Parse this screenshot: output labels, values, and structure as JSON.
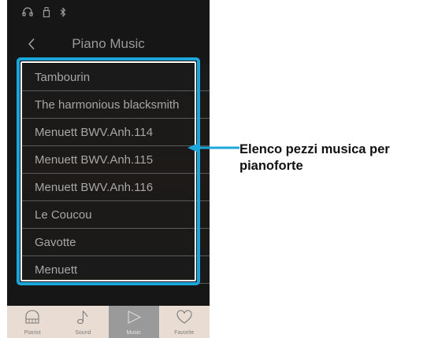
{
  "status_bar": {
    "icons": [
      "headphones-icon",
      "usb-icon",
      "bluetooth-icon"
    ]
  },
  "header": {
    "back_icon": "chevron-left-icon",
    "title": "Piano Music"
  },
  "list": {
    "items": [
      "Tambourin",
      "The harmonious blacksmith",
      "Menuett BWV.Anh.114",
      "Menuett BWV.Anh.115",
      "Menuett BWV.Anh.116",
      "Le Coucou",
      "Gavotte",
      "Menuett"
    ]
  },
  "tabs": [
    {
      "label": "Pianist",
      "icon": "piano-icon",
      "active": false
    },
    {
      "label": "Sound",
      "icon": "music-note-icon",
      "active": false
    },
    {
      "label": "Music",
      "icon": "play-icon",
      "active": true
    },
    {
      "label": "Favorite",
      "icon": "heart-icon",
      "active": false
    }
  ],
  "callout": {
    "text": "Elenco pezzi musica per pianoforte"
  },
  "colors": {
    "highlight": "#1ba7dc",
    "screen_background": "#161616",
    "tabbar_background": "#e9dcd3",
    "active_tab": "#9a9a9a"
  }
}
